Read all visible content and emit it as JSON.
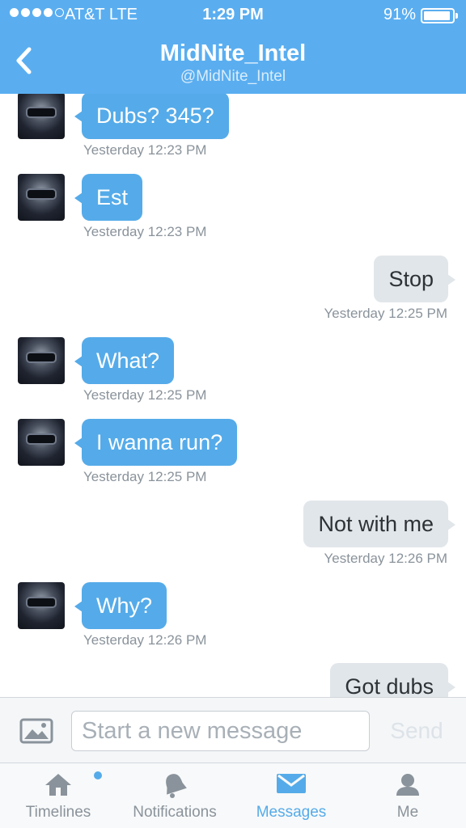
{
  "status_bar": {
    "carrier": "AT&T  LTE",
    "time": "1:29 PM",
    "battery": "91%",
    "signal_bars_filled": 4,
    "signal_bars_total": 5
  },
  "header": {
    "title": "MidNite_Intel",
    "handle": "@MidNite_Intel",
    "back_icon": "chevron-left-icon"
  },
  "messages": [
    {
      "direction": "in",
      "text": "Dubs? 345?",
      "time": "Yesterday 12:23 PM"
    },
    {
      "direction": "in",
      "text": "Est",
      "time": "Yesterday 12:23 PM"
    },
    {
      "direction": "out",
      "text": "Stop",
      "time": "Yesterday 12:25 PM"
    },
    {
      "direction": "in",
      "text": "What?",
      "time": "Yesterday 12:25 PM"
    },
    {
      "direction": "in",
      "text": "I wanna run?",
      "time": "Yesterday 12:25 PM"
    },
    {
      "direction": "out",
      "text": "Not with me",
      "time": "Yesterday 12:26 PM"
    },
    {
      "direction": "in",
      "text": "Why?",
      "time": "Yesterday 12:26 PM"
    },
    {
      "direction": "out",
      "text": "Got dubs",
      "time": ""
    }
  ],
  "compose": {
    "placeholder": "Start a new message",
    "value": "",
    "send_label": "Send",
    "photo_icon": "photo-icon"
  },
  "tabbar": {
    "items": [
      {
        "label": "Timelines",
        "icon": "home-icon",
        "active": false,
        "has_badge": true
      },
      {
        "label": "Notifications",
        "icon": "bell-icon",
        "active": false
      },
      {
        "label": "Messages",
        "icon": "envelope-icon",
        "active": true
      },
      {
        "label": "Me",
        "icon": "person-icon",
        "active": false
      }
    ]
  },
  "colors": {
    "header_blue": "#5aaef0",
    "incoming_bubble": "#55abe9",
    "outgoing_bubble": "#e1e6ea",
    "active_tab": "#55abe9",
    "inactive_tab": "#8a939b"
  }
}
